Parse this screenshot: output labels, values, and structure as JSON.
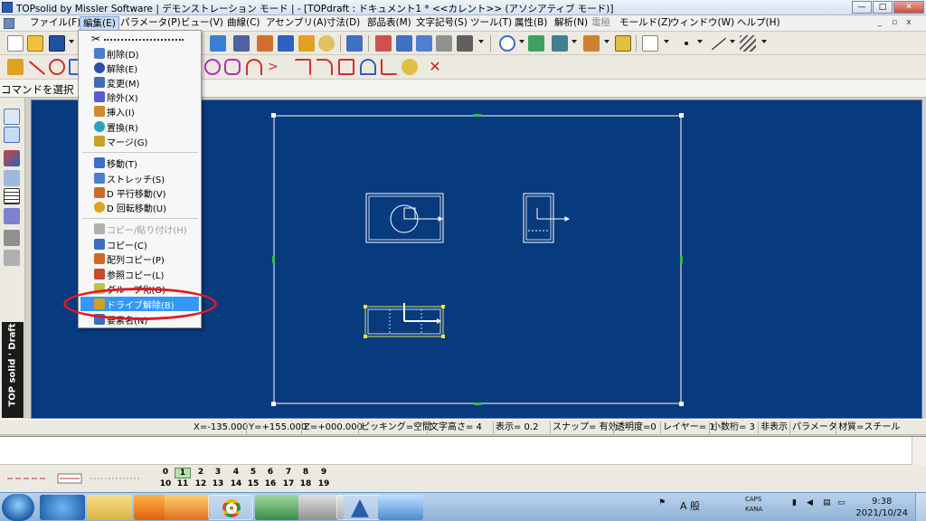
{
  "window": {
    "title": "TOPsolid by Missler Software | デモンストレーション モード | - [TOPdraft : ドキュメント1 *  <<カレント>> (アソシアティブ モード)]",
    "controls": [
      "—",
      "□",
      "✕"
    ]
  },
  "menubar": {
    "items": [
      "ファイル(F)",
      "編集(E)",
      "パラメータ(P)",
      "ビュー(V)",
      "曲線(C)",
      "アセンブリ(A)",
      "寸法(D)",
      "部品表(M)",
      "文字記号(S)",
      "ツール(T)",
      "属性(B)",
      "解析(N)",
      "電極",
      "モールド(Z)",
      "ウィンドウ(W)",
      "ヘルプ(H)"
    ],
    "active": "編集(E)",
    "disabled": "電極",
    "mdi_controls": [
      "_",
      "▫",
      "x"
    ]
  },
  "prompt": {
    "text": "コマンドを選択"
  },
  "edit_menu": {
    "groups": [
      [
        {
          "label": "削除(D)",
          "icon": "delete-icon",
          "color": "#4a7dc8"
        },
        {
          "label": "解除(E)",
          "icon": "release-icon",
          "color": "#2d4fa8"
        },
        {
          "label": "変更(M)",
          "icon": "modify-icon",
          "color": "#3c6fb8"
        },
        {
          "label": "除外(X)",
          "icon": "exclude-icon",
          "color": "#5a5ad0"
        },
        {
          "label": "挿入(I)",
          "icon": "insert-icon",
          "color": "#d08a2a"
        },
        {
          "label": "置換(R)",
          "icon": "replace-icon",
          "color": "#2aa0c8"
        },
        {
          "label": "マージ(G)",
          "icon": "merge-icon",
          "color": "#c8a02a"
        }
      ],
      [
        {
          "label": "移動(T)",
          "icon": "move-icon",
          "color": "#3a6fc0"
        },
        {
          "label": "ストレッチ(S)",
          "icon": "stretch-icon",
          "color": "#4b7fd0"
        },
        {
          "label": "D 平行移動(V)",
          "icon": "translate-icon",
          "color": "#d06a2a"
        },
        {
          "label": "D 回転移動(U)",
          "icon": "rotate-icon",
          "color": "#e0a020"
        }
      ],
      [
        {
          "label": "コピー/貼り付け(H)",
          "icon": "paste-icon",
          "color": "#b0b0b0",
          "disabled": true
        },
        {
          "label": "コピー(C)",
          "icon": "copy-icon",
          "color": "#3a6fc0"
        },
        {
          "label": "配列コピー(P)",
          "icon": "array-copy-icon",
          "color": "#d06a2a"
        },
        {
          "label": "参照コピー(L)",
          "icon": "reference-copy-icon",
          "color": "#c84a2a"
        },
        {
          "label": "グループ化(O)",
          "icon": "group-icon",
          "color": "#c0c040"
        },
        {
          "label": "ドライブ解除(B)",
          "icon": "undrive-icon",
          "color": "#d0a020",
          "highlight": true
        },
        {
          "label": "要素名(N)",
          "icon": "element-name-icon",
          "color": "#3a6fc0"
        }
      ]
    ]
  },
  "statusbar": {
    "cells": [
      "X=-135.000",
      "Y=+155.000",
      "Z=+000.000",
      "ピッキング=空間",
      "文字高さ=  4",
      "表示=   0.2",
      "スナップ= 有効",
      "透明度=0",
      "レイヤー=  1",
      "小数桁= 3",
      "非表示",
      "パラメータ",
      "材質=スチール"
    ]
  },
  "layers": {
    "row1": [
      "0",
      "1",
      "2",
      "3",
      "4",
      "5",
      "6",
      "7",
      "8",
      "9"
    ],
    "row2": [
      "10",
      "11",
      "12",
      "13",
      "14",
      "15",
      "16",
      "17",
      "18",
      "19"
    ],
    "active": "1"
  },
  "brand": {
    "text": "TOP solid ' Draft"
  },
  "taskbar": {
    "ime": "A 般",
    "caps": "CAPS",
    "kana": "KANA",
    "time": "9:38",
    "date": "2021/10/24"
  },
  "colors": {
    "canvas": "#083a7e",
    "highlight": "#3399ff",
    "annotation": "#e01b24"
  }
}
